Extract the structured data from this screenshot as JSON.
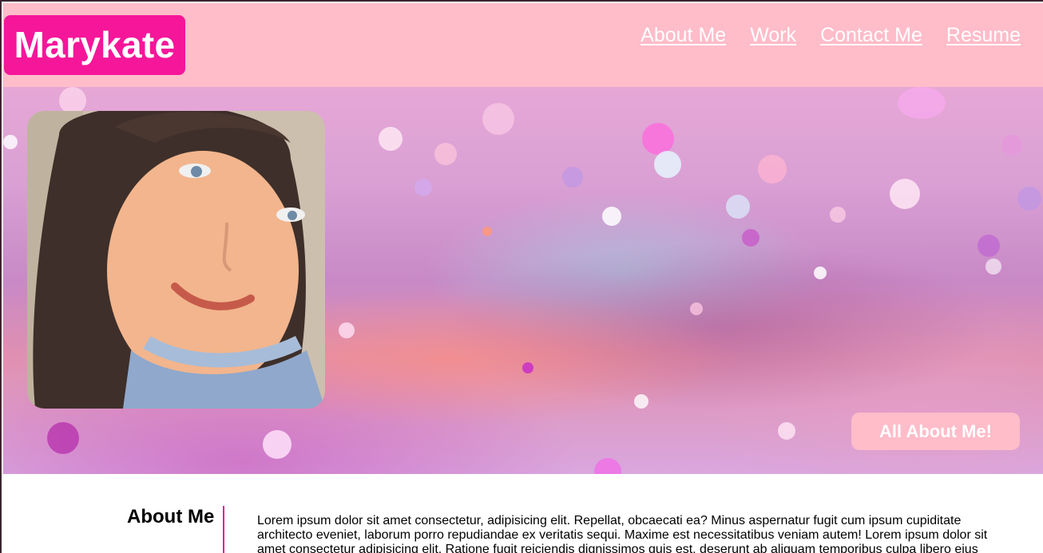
{
  "brand": {
    "name": "Marykate"
  },
  "nav": {
    "items": [
      {
        "label": "About Me"
      },
      {
        "label": "Work"
      },
      {
        "label": "Contact Me"
      },
      {
        "label": "Resume"
      }
    ]
  },
  "hero": {
    "cta_label": "All About Me!"
  },
  "about": {
    "title": "About Me",
    "body": "Lorem ipsum dolor sit amet consectetur, adipisicing elit. Repellat, obcaecati ea? Minus aspernatur fugit cum ipsum cupiditate architecto eveniet, laborum porro repudiandae ex veritatis sequi. Maxime est necessitatibus veniam autem! Lorem ipsum dolor sit amet consectetur adipisicing elit. Ratione fugit reiciendis dignissimos quis est, deserunt ab aliquam temporibus culpa libero eius"
  },
  "colors": {
    "header_bg": "#ffbcc9",
    "brand_bg": "#f5169a",
    "accent": "#e0168a",
    "text_light": "#ffffff"
  }
}
